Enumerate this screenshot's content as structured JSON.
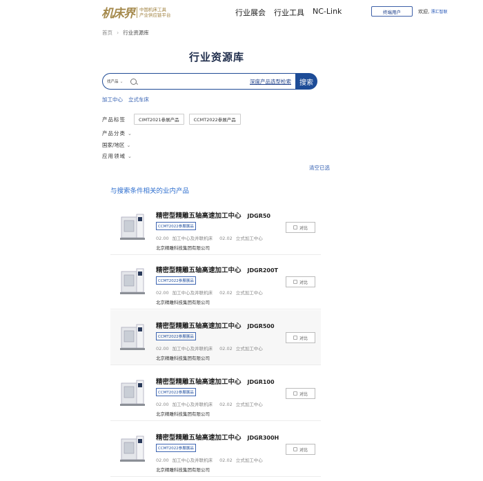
{
  "header": {
    "logo_mark": "机床界",
    "logo_line1": "中国机床工具",
    "logo_line2": "产业供应链平台",
    "nav": [
      "行业展会",
      "行业工具",
      "NC-Link"
    ],
    "terminal_btn": "终端用户",
    "welcome": "欢迎,",
    "username": "漂汇智联"
  },
  "breadcrumb": {
    "home": "首页",
    "current": "行业资源库"
  },
  "page_title": "行业资源库",
  "search": {
    "category": "找产品",
    "placeholder": "",
    "deep_link": "深度产品选型检索",
    "button": "搜索"
  },
  "quick_links": [
    "加工中心",
    "立式车床"
  ],
  "filters": {
    "product_tag_label": "产品标签",
    "tags": [
      "CIMT2021参展产品",
      "CCMT2022参展产品"
    ],
    "product_category": "产品分类",
    "country_region": "国家/地区",
    "application_field": "应用领域",
    "clear": "清空已选"
  },
  "section_title": "与搜索条件相关的业内产品",
  "products": [
    {
      "name": "精密型精雕五轴高速加工中心",
      "model": "JDGR50",
      "badge": "CCMT2022参展展品",
      "cat1_code": "02.00",
      "cat1": "加工中心及并联机床",
      "cat2_code": "02.02",
      "cat2": "立式加工中心",
      "company": "北京精雕科技集团有限公司",
      "compare": "对比"
    },
    {
      "name": "精密型精雕五轴高速加工中心",
      "model": "JDGR200T",
      "badge": "CCMT2022参展展品",
      "cat1_code": "02.00",
      "cat1": "加工中心及并联机床",
      "cat2_code": "02.02",
      "cat2": "立式加工中心",
      "company": "北京精雕科技集团有限公司",
      "compare": "对比"
    },
    {
      "name": "精密型精雕五轴高速加工中心",
      "model": "JDGR500",
      "badge": "CCMT2022参展展品",
      "cat1_code": "02.00",
      "cat1": "加工中心及并联机床",
      "cat2_code": "02.02",
      "cat2": "立式加工中心",
      "company": "北京精雕科技集团有限公司",
      "compare": "对比"
    },
    {
      "name": "精密型精雕五轴高速加工中心",
      "model": "JDGR100",
      "badge": "CCMT2022参展展品",
      "cat1_code": "02.00",
      "cat1": "加工中心及并联机床",
      "cat2_code": "02.02",
      "cat2": "立式加工中心",
      "company": "北京精雕科技集团有限公司",
      "compare": "对比"
    },
    {
      "name": "精密型精雕五轴高速加工中心",
      "model": "JDGR300H",
      "badge": "CCMT2022参展展品",
      "cat1_code": "02.00",
      "cat1": "加工中心及并联机床",
      "cat2_code": "02.02",
      "cat2": "立式加工中心",
      "company": "北京精雕科技集团有限公司",
      "compare": "对比"
    }
  ],
  "colors": {
    "accent": "#1d4c97",
    "link": "#2f5cb0",
    "section": "#2f6fcf",
    "logo": "#a58a4d"
  }
}
